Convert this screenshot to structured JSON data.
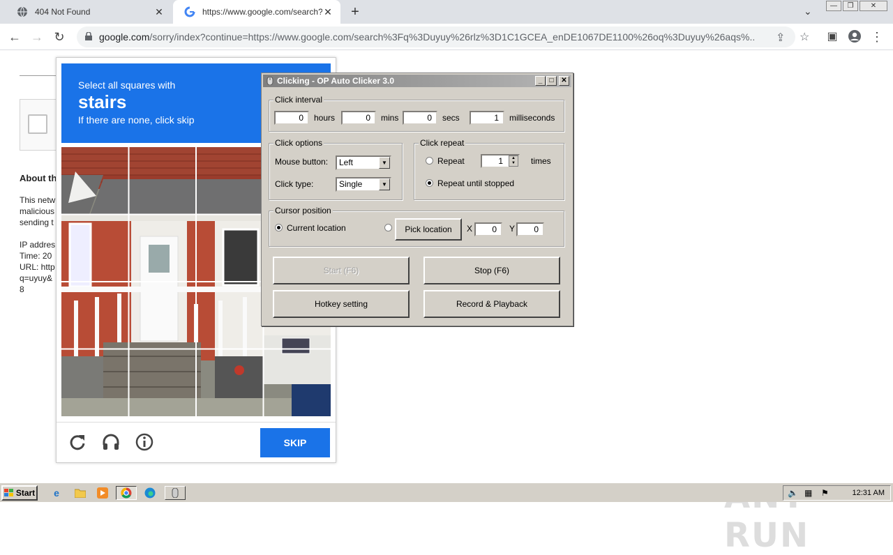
{
  "browser": {
    "tabs": [
      {
        "title": "404 Not Found",
        "active": false
      },
      {
        "title": "https://www.google.com/search?q=",
        "active": true
      }
    ],
    "url_domain": "google.com",
    "url_rest": "/sorry/index?continue=https://www.google.com/search%3Fq%3Duyuy%26rlz%3D1C1GCEA_enDE1067DE1100%26oq%3Duyuy%26aqs%..."
  },
  "page": {
    "about_heading": "About th",
    "lines": [
      "This netw",
      "malicious",
      "sending t",
      "",
      "IP addres",
      "Time: 20",
      "URL: http",
      "q=uyuy&",
      "8"
    ]
  },
  "captcha": {
    "line1": "Select all squares with",
    "keyword": "stairs",
    "line3": "If there are none, click skip",
    "skip_label": "SKIP"
  },
  "autoclicker": {
    "title": "Clicking - OP Auto Clicker 3.0",
    "interval": {
      "label": "Click interval",
      "hours": "0",
      "hours_label": "hours",
      "mins": "0",
      "mins_label": "mins",
      "secs": "0",
      "secs_label": "secs",
      "ms": "1",
      "ms_label": "milliseconds"
    },
    "options": {
      "label": "Click options",
      "mouse_button_label": "Mouse button:",
      "mouse_button": "Left",
      "click_type_label": "Click type:",
      "click_type": "Single"
    },
    "repeat": {
      "label": "Click repeat",
      "repeat_label": "Repeat",
      "times_value": "1",
      "times_label": "times",
      "until_stopped_label": "Repeat until stopped"
    },
    "cursor": {
      "label": "Cursor position",
      "current_label": "Current location",
      "pick_label": "Pick location",
      "x_label": "X",
      "x_value": "0",
      "y_label": "Y",
      "y_value": "0"
    },
    "buttons": {
      "start": "Start (F6)",
      "stop": "Stop (F6)",
      "hotkey": "Hotkey setting",
      "record": "Record & Playback"
    }
  },
  "watermark": "ANY RUN",
  "taskbar": {
    "start": "Start",
    "clock": "12:31 AM"
  }
}
